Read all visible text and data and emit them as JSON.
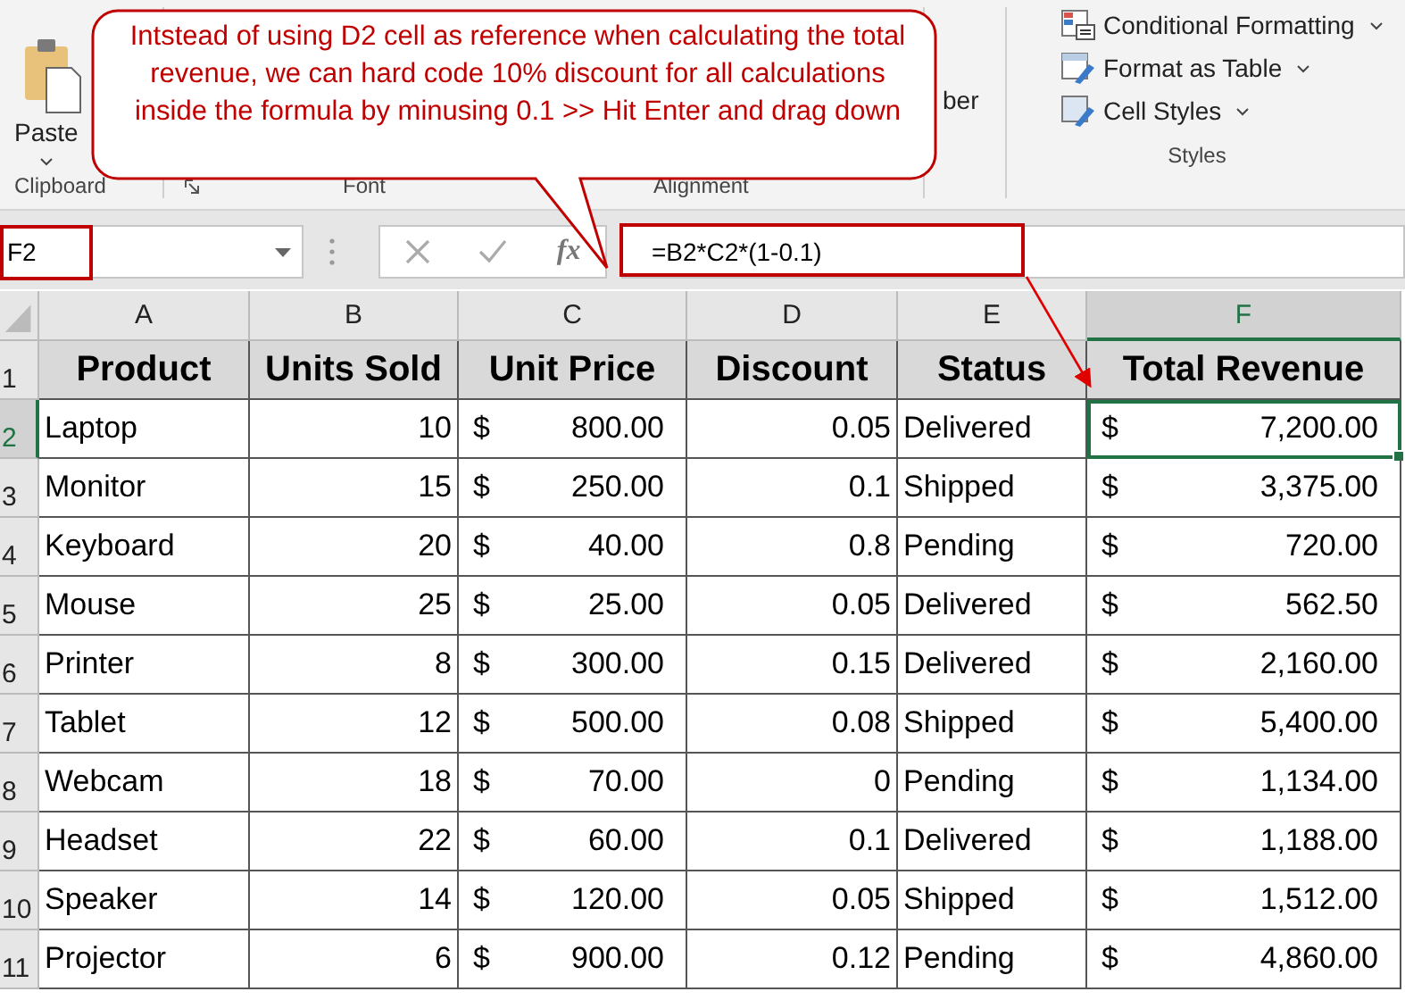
{
  "ribbon": {
    "clipboard": {
      "button": "Paste",
      "label": "Clipboard"
    },
    "partial_labels": [
      "Font",
      "Alignment"
    ],
    "number_fragment": "ber",
    "styles": {
      "items": [
        {
          "label": "Conditional Formatting"
        },
        {
          "label": "Format as Table"
        },
        {
          "label": "Cell Styles"
        }
      ],
      "label": "Styles"
    }
  },
  "callout": {
    "text": "Intstead of using D2 cell as reference when calculating the total revenue, we can hard code 10% discount for all calculations inside the formula by minusing 0.1 >> Hit Enter and drag down"
  },
  "name_box": {
    "value": "F2"
  },
  "formula_bar": {
    "value": "=B2*C2*(1-0.1)"
  },
  "fx_label": "fx",
  "sheet": {
    "columns": [
      {
        "label": "A",
        "selected": false
      },
      {
        "label": "B",
        "selected": false
      },
      {
        "label": "C",
        "selected": false
      },
      {
        "label": "D",
        "selected": false
      },
      {
        "label": "E",
        "selected": false
      },
      {
        "label": "F",
        "selected": true
      }
    ],
    "rows": [
      {
        "number": "1",
        "selected": false,
        "cells": [
          {
            "kind": "header",
            "text": "Product"
          },
          {
            "kind": "header",
            "text": "Units Sold"
          },
          {
            "kind": "header",
            "text": "Unit Price"
          },
          {
            "kind": "header",
            "text": "Discount"
          },
          {
            "kind": "header",
            "text": "Status"
          },
          {
            "kind": "header",
            "text": "Total Revenue"
          }
        ]
      },
      {
        "number": "2",
        "selected": true,
        "cells": [
          {
            "kind": "text",
            "text": "Laptop"
          },
          {
            "kind": "number",
            "text": "10"
          },
          {
            "kind": "currency",
            "symbol": "$",
            "text": "800.00"
          },
          {
            "kind": "number",
            "text": "0.05"
          },
          {
            "kind": "text",
            "text": "Delivered"
          },
          {
            "kind": "currency",
            "symbol": "$",
            "text": "7,200.00",
            "selected": true
          }
        ]
      },
      {
        "number": "3",
        "selected": false,
        "cells": [
          {
            "kind": "text",
            "text": "Monitor"
          },
          {
            "kind": "number",
            "text": "15"
          },
          {
            "kind": "currency",
            "symbol": "$",
            "text": "250.00"
          },
          {
            "kind": "number",
            "text": "0.1"
          },
          {
            "kind": "text",
            "text": "Shipped"
          },
          {
            "kind": "currency",
            "symbol": "$",
            "text": "3,375.00"
          }
        ]
      },
      {
        "number": "4",
        "selected": false,
        "cells": [
          {
            "kind": "text",
            "text": "Keyboard"
          },
          {
            "kind": "number",
            "text": "20"
          },
          {
            "kind": "currency",
            "symbol": "$",
            "text": "40.00"
          },
          {
            "kind": "number",
            "text": "0.8"
          },
          {
            "kind": "text",
            "text": "Pending"
          },
          {
            "kind": "currency",
            "symbol": "$",
            "text": "720.00"
          }
        ]
      },
      {
        "number": "5",
        "selected": false,
        "cells": [
          {
            "kind": "text",
            "text": "Mouse"
          },
          {
            "kind": "number",
            "text": "25"
          },
          {
            "kind": "currency",
            "symbol": "$",
            "text": "25.00"
          },
          {
            "kind": "number",
            "text": "0.05"
          },
          {
            "kind": "text",
            "text": "Delivered"
          },
          {
            "kind": "currency",
            "symbol": "$",
            "text": "562.50"
          }
        ]
      },
      {
        "number": "6",
        "selected": false,
        "cells": [
          {
            "kind": "text",
            "text": "Printer"
          },
          {
            "kind": "number",
            "text": "8"
          },
          {
            "kind": "currency",
            "symbol": "$",
            "text": "300.00"
          },
          {
            "kind": "number",
            "text": "0.15"
          },
          {
            "kind": "text",
            "text": "Delivered"
          },
          {
            "kind": "currency",
            "symbol": "$",
            "text": "2,160.00"
          }
        ]
      },
      {
        "number": "7",
        "selected": false,
        "cells": [
          {
            "kind": "text",
            "text": "Tablet"
          },
          {
            "kind": "number",
            "text": "12"
          },
          {
            "kind": "currency",
            "symbol": "$",
            "text": "500.00"
          },
          {
            "kind": "number",
            "text": "0.08"
          },
          {
            "kind": "text",
            "text": "Shipped"
          },
          {
            "kind": "currency",
            "symbol": "$",
            "text": "5,400.00"
          }
        ]
      },
      {
        "number": "8",
        "selected": false,
        "cells": [
          {
            "kind": "text",
            "text": "Webcam"
          },
          {
            "kind": "number",
            "text": "18"
          },
          {
            "kind": "currency",
            "symbol": "$",
            "text": "70.00"
          },
          {
            "kind": "number",
            "text": "0"
          },
          {
            "kind": "text",
            "text": "Pending"
          },
          {
            "kind": "currency",
            "symbol": "$",
            "text": "1,134.00"
          }
        ]
      },
      {
        "number": "9",
        "selected": false,
        "cells": [
          {
            "kind": "text",
            "text": "Headset"
          },
          {
            "kind": "number",
            "text": "22"
          },
          {
            "kind": "currency",
            "symbol": "$",
            "text": "60.00"
          },
          {
            "kind": "number",
            "text": "0.1"
          },
          {
            "kind": "text",
            "text": "Delivered"
          },
          {
            "kind": "currency",
            "symbol": "$",
            "text": "1,188.00"
          }
        ]
      },
      {
        "number": "10",
        "selected": false,
        "cells": [
          {
            "kind": "text",
            "text": "Speaker"
          },
          {
            "kind": "number",
            "text": "14"
          },
          {
            "kind": "currency",
            "symbol": "$",
            "text": "120.00"
          },
          {
            "kind": "number",
            "text": "0.05"
          },
          {
            "kind": "text",
            "text": "Shipped"
          },
          {
            "kind": "currency",
            "symbol": "$",
            "text": "1,512.00"
          }
        ]
      },
      {
        "number": "11",
        "selected": false,
        "cells": [
          {
            "kind": "text",
            "text": "Projector"
          },
          {
            "kind": "number",
            "text": "6"
          },
          {
            "kind": "currency",
            "symbol": "$",
            "text": "900.00"
          },
          {
            "kind": "number",
            "text": "0.12"
          },
          {
            "kind": "text",
            "text": "Pending"
          },
          {
            "kind": "currency",
            "symbol": "$",
            "text": "4,860.00"
          }
        ]
      }
    ]
  }
}
